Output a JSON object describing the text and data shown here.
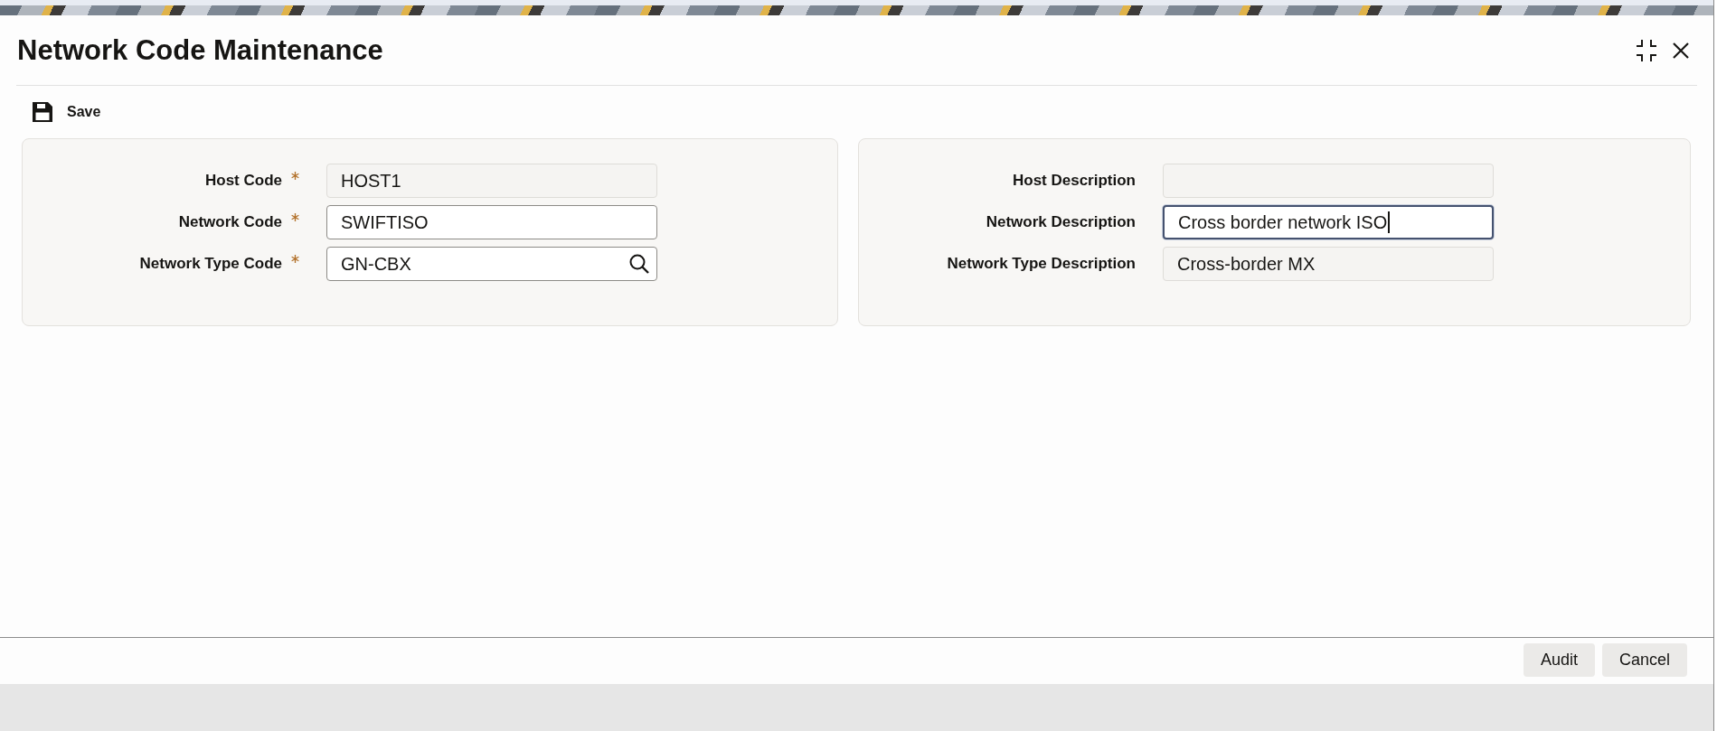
{
  "header": {
    "title": "Network Code Maintenance"
  },
  "toolbar": {
    "save_label": "Save"
  },
  "panels": [
    {
      "fields": [
        {
          "label": "Host Code",
          "required": true,
          "kind": "readonly",
          "value": "HOST1",
          "focused": false
        },
        {
          "label": "Network Code",
          "required": true,
          "kind": "text",
          "value": "SWIFTISO",
          "focused": false
        },
        {
          "label": "Network Type Code",
          "required": true,
          "kind": "lookup",
          "value": "GN-CBX",
          "focused": false
        }
      ]
    },
    {
      "fields": [
        {
          "label": "Host Description",
          "required": false,
          "kind": "readonly",
          "focused": false
        },
        {
          "label": "Network Description",
          "required": false,
          "kind": "text",
          "value": "Cross border network ISO",
          "focused": true
        },
        {
          "label": "Network Type Description",
          "required": false,
          "kind": "readonly",
          "value": "Cross-border MX",
          "focused": false
        }
      ]
    }
  ],
  "footer": {
    "buttons": [
      {
        "label": "Audit"
      },
      {
        "label": "Cancel"
      }
    ]
  }
}
